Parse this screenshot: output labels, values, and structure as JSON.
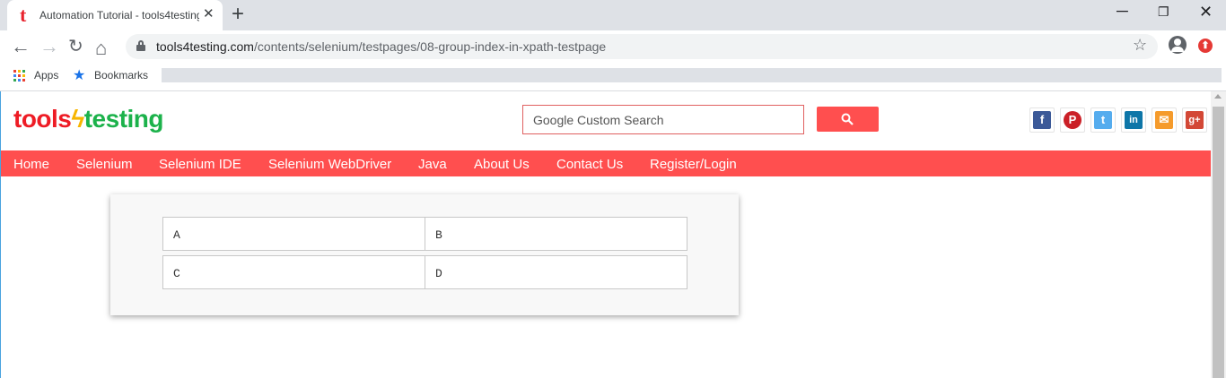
{
  "browser": {
    "tab_title": "Automation Tutorial - tools4testing",
    "tab_favicon": "t",
    "close_tab_icon": "close-icon",
    "new_tab_icon": "plus-icon",
    "url_host": "tools4testing.com",
    "url_path": "/contents/selenium/testpages/08-group-index-in-xpath-testpage",
    "bookmarks": [
      {
        "label": "Apps",
        "icon": "apps-grid-icon"
      },
      {
        "label": "Bookmarks",
        "icon": "star-icon"
      }
    ],
    "window_controls": {
      "minimize": "─",
      "maximize": "❐",
      "close": "✕"
    },
    "nav_glyphs": {
      "back": "←",
      "forward": "→",
      "reload": "↻",
      "home": "⌂",
      "star": "☆"
    }
  },
  "site": {
    "logo": {
      "part1": "tools",
      "part2": "ϟ",
      "part3": "testing"
    },
    "search": {
      "placeholder": "Google Custom Search"
    },
    "social_icons": [
      {
        "name": "facebook-icon",
        "glyph": "f",
        "color": "#3b5998"
      },
      {
        "name": "pinterest-icon",
        "glyph": "P",
        "color": "#cb2027"
      },
      {
        "name": "twitter-icon",
        "glyph": "t",
        "color": "#55acee"
      },
      {
        "name": "linkedin-icon",
        "glyph": "in",
        "color": "#0e76a8"
      },
      {
        "name": "email-icon",
        "glyph": "✉",
        "color": "#f59b2c"
      },
      {
        "name": "google-plus-icon",
        "glyph": "g+",
        "color": "#d34836"
      }
    ],
    "nav": [
      "Home",
      "Selenium",
      "Selenium IDE",
      "Selenium WebDriver",
      "Java",
      "About Us",
      "Contact Us",
      "Register/Login"
    ],
    "accent_color": "#ff4f4f"
  },
  "grid": {
    "cells": [
      "A",
      "B",
      "C",
      "D"
    ]
  }
}
